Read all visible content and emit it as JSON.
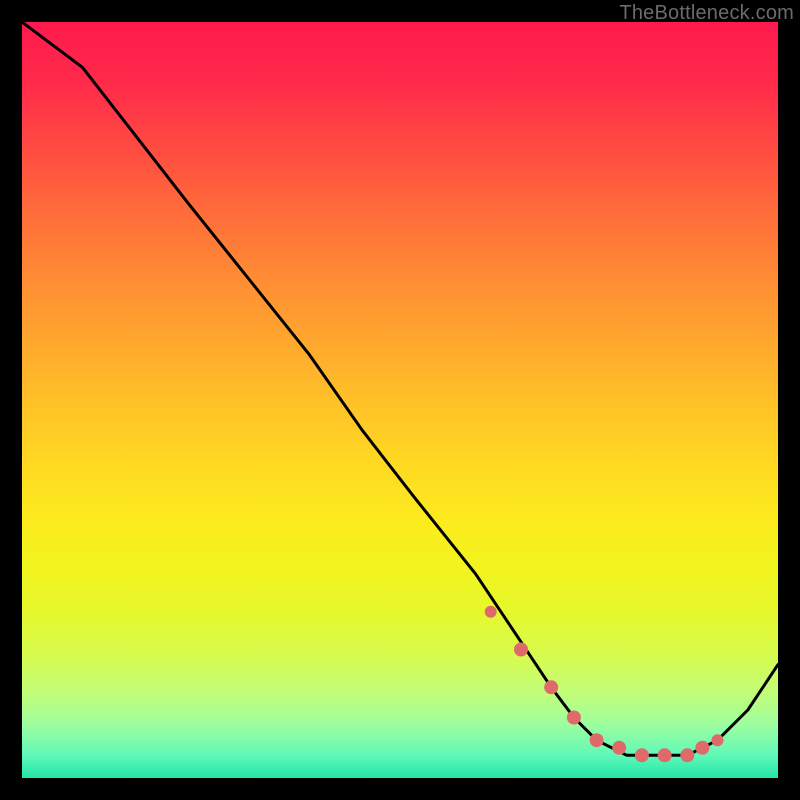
{
  "watermark": "TheBottleneck.com",
  "colors": {
    "curve": "#000000",
    "dots": "#e06a6a"
  },
  "chart_data": {
    "type": "line",
    "title": "",
    "xlabel": "",
    "ylabel": "",
    "xlim": [
      0,
      100
    ],
    "ylim": [
      0,
      100
    ],
    "grid": false,
    "legend": false,
    "series": [
      {
        "name": "bottleneck-curve",
        "x": [
          0,
          8,
          15,
          22,
          30,
          38,
          45,
          52,
          60,
          66,
          70,
          73,
          76,
          80,
          84,
          88,
          92,
          96,
          100
        ],
        "values": [
          100,
          94,
          85,
          76,
          66,
          56,
          46,
          37,
          27,
          18,
          12,
          8,
          5,
          3,
          3,
          3,
          5,
          9,
          15
        ]
      }
    ],
    "highlights": {
      "name": "valley-dots",
      "x": [
        62,
        66,
        70,
        73,
        76,
        79,
        82,
        85,
        88,
        90,
        92
      ],
      "values": [
        22,
        17,
        12,
        8,
        5,
        4,
        3,
        3,
        3,
        4,
        5
      ]
    }
  }
}
